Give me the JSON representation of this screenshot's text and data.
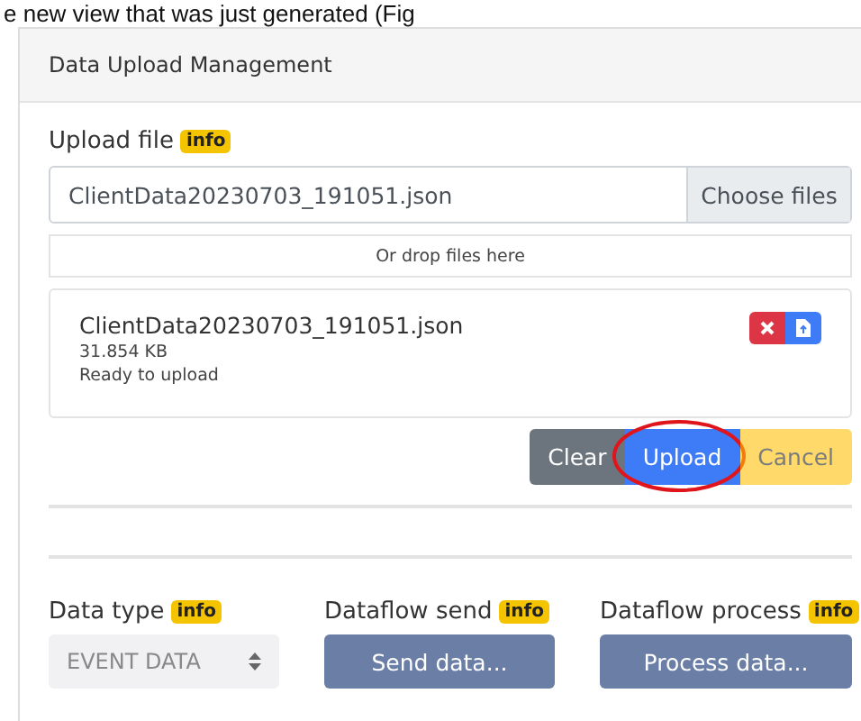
{
  "document_text": "e new view that was just generated (Fig",
  "panel": {
    "title": "Data Upload Management"
  },
  "upload": {
    "label": "Upload file",
    "badge": "info",
    "file_field": {
      "value": "ClientData20230703_191051.json"
    },
    "choose_button": "Choose files",
    "drop_zone": "Or drop files here",
    "files": [
      {
        "name": "ClientData20230703_191051.json",
        "size": "31.854 KB",
        "status": "Ready to upload"
      }
    ],
    "actions": [
      {
        "label": "Clear",
        "kind": "secondary",
        "disabled": false,
        "highlighted": false
      },
      {
        "label": "Upload",
        "kind": "primary",
        "disabled": false,
        "highlighted": true
      },
      {
        "label": "Cancel",
        "kind": "warning",
        "disabled": true,
        "highlighted": false
      }
    ]
  },
  "controls": [
    {
      "kind": "select",
      "label": "Data type",
      "badge": "info",
      "value": "EVENT DATA",
      "disabled": true
    },
    {
      "kind": "button",
      "label": "Dataflow send",
      "badge": "info",
      "value": "Send data..."
    },
    {
      "kind": "button",
      "label": "Dataflow process",
      "badge": "info",
      "value": "Process data..."
    }
  ]
}
